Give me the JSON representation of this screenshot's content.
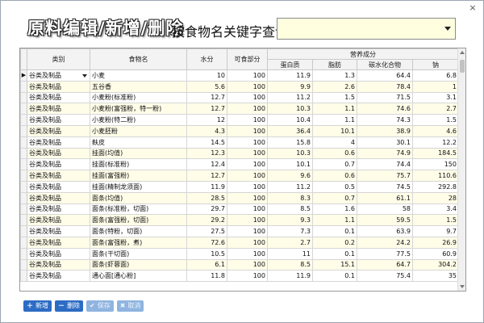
{
  "window": {
    "close_label": "×"
  },
  "header": {
    "title": "原料编辑/新增/删除",
    "search_label": "按食物名关键字查询",
    "search_value": ""
  },
  "table": {
    "group_header": "营养成分",
    "columns": [
      "类别",
      "食物名",
      "水分",
      "可食部分",
      "蛋白质",
      "脂肪",
      "碳水化合物",
      "钠"
    ],
    "current_row_marker": "▶",
    "rows": [
      [
        "谷类及制品",
        "小麦",
        "10",
        "100",
        "11.9",
        "1.3",
        "64.4",
        "6.8"
      ],
      [
        "谷类及制品",
        "五谷香",
        "5.6",
        "100",
        "9.9",
        "2.6",
        "78.4",
        "1"
      ],
      [
        "谷类及制品",
        "小麦粉(标准粉)",
        "12.7",
        "100",
        "11.2",
        "1.5",
        "71.5",
        "3.1"
      ],
      [
        "谷类及制品",
        "小麦粉(富强粉，特一粉)",
        "12.7",
        "100",
        "10.3",
        "1.1",
        "74.6",
        "2.7"
      ],
      [
        "谷类及制品",
        "小麦粉(特二粉)",
        "12",
        "100",
        "10.4",
        "1.1",
        "74.3",
        "1.5"
      ],
      [
        "谷类及制品",
        "小麦胚粉",
        "4.3",
        "100",
        "36.4",
        "10.1",
        "38.9",
        "4.6"
      ],
      [
        "谷类及制品",
        "麸皮",
        "14.5",
        "100",
        "15.8",
        "4",
        "30.1",
        "12.2"
      ],
      [
        "谷类及制品",
        "挂面(均值)",
        "12.3",
        "100",
        "10.3",
        "0.6",
        "74.9",
        "184.5"
      ],
      [
        "谷类及制品",
        "挂面(标准粉)",
        "12.4",
        "100",
        "10.1",
        "0.7",
        "74.4",
        "150"
      ],
      [
        "谷类及制品",
        "挂面(富强粉)",
        "12.7",
        "100",
        "9.6",
        "0.6",
        "75.7",
        "110.6"
      ],
      [
        "谷类及制品",
        "挂面(精制龙须面)",
        "11.9",
        "100",
        "11.2",
        "0.5",
        "74.5",
        "292.8"
      ],
      [
        "谷类及制品",
        "面条(均值)",
        "28.5",
        "100",
        "8.3",
        "0.7",
        "61.1",
        "28"
      ],
      [
        "谷类及制品",
        "面条(标准粉，切面)",
        "29.7",
        "100",
        "8.5",
        "1.6",
        "58",
        "3.4"
      ],
      [
        "谷类及制品",
        "面条(富强粉，切面)",
        "29.2",
        "100",
        "9.3",
        "1.1",
        "59.5",
        "1.5"
      ],
      [
        "谷类及制品",
        "面条(特粉，切面)",
        "27.5",
        "100",
        "7.3",
        "0.1",
        "63.9",
        "9.7"
      ],
      [
        "谷类及制品",
        "面条(富强粉，煮)",
        "72.6",
        "100",
        "2.7",
        "0.2",
        "24.2",
        "26.9"
      ],
      [
        "谷类及制品",
        "面条(干切面)",
        "10.5",
        "100",
        "11",
        "0.1",
        "77.5",
        "60.9"
      ],
      [
        "谷类及制品",
        "面条(虾蓉面)",
        "6.1",
        "100",
        "8.5",
        "15.1",
        "64.7",
        "304.2"
      ],
      [
        "谷类及制品",
        "通心面[通心粉]",
        "11.8",
        "100",
        "11.9",
        "0.1",
        "75.4",
        "35"
      ]
    ]
  },
  "toolbar": {
    "add_label": "新增",
    "delete_label": "删除",
    "save_label": "保存",
    "cancel_label": "取消"
  },
  "colors": {
    "accent": "#2c6cc4",
    "row_alt": "#fffde8",
    "search_bg": "#ffffe0"
  }
}
